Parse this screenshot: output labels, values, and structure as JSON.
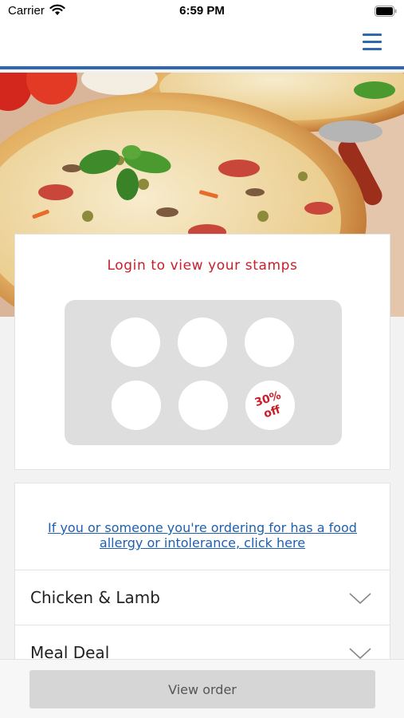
{
  "status_bar": {
    "carrier": "Carrier",
    "time": "6:59 PM"
  },
  "nav": {
    "menu_icon": "hamburger-menu-icon",
    "accent_color": "#2f67b1"
  },
  "hero": {
    "image": "pizza-photo"
  },
  "stamps": {
    "title": "Login to view your stamps",
    "reward_label": "30%\noff",
    "stamp_count": 6,
    "stamps_collected": 0
  },
  "menu": {
    "allergy_link": "If you or someone you're ordering for has a food allergy or intolerance, click here",
    "categories": [
      {
        "label": "Chicken & Lamb"
      },
      {
        "label": "Meal Deal"
      }
    ]
  },
  "order": {
    "view_order_label": "View order"
  },
  "colors": {
    "brand_red": "#c8202a",
    "link_blue": "#1f5fb0"
  }
}
